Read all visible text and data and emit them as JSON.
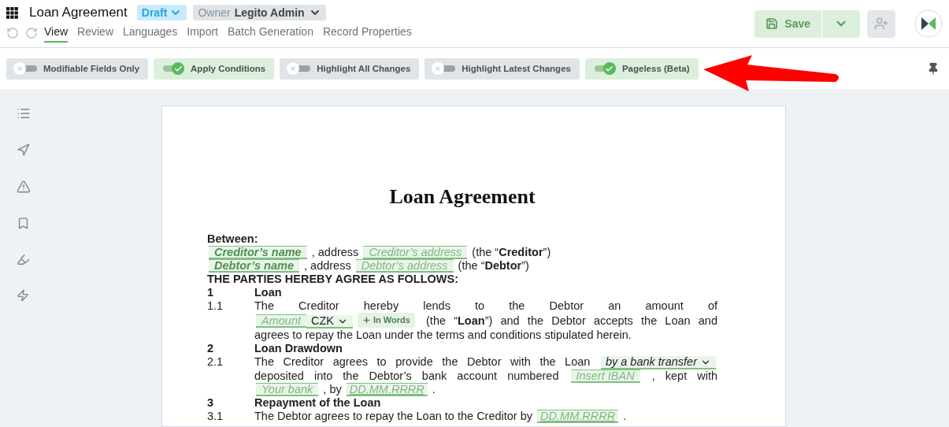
{
  "header": {
    "title": "Loan Agreement",
    "status": "Draft",
    "owner_label": "Owner",
    "owner_name": "Legito Admin"
  },
  "tabs": [
    {
      "label": "View",
      "selected": true
    },
    {
      "label": "Review",
      "selected": false
    },
    {
      "label": "Languages",
      "selected": false
    },
    {
      "label": "Import",
      "selected": false
    },
    {
      "label": "Batch Generation",
      "selected": false
    },
    {
      "label": "Record Properties",
      "selected": false
    }
  ],
  "save_button": {
    "label": "Save"
  },
  "toggles": [
    {
      "label": "Modifiable Fields Only",
      "on": false
    },
    {
      "label": "Apply Conditions",
      "on": true
    },
    {
      "label": "Highlight All Changes",
      "on": false
    },
    {
      "label": "Highlight Latest Changes",
      "on": false
    },
    {
      "label": "Pageless (Beta)",
      "on": true
    }
  ],
  "document": {
    "title": "Loan Agreement",
    "blocks": [
      {
        "kind": "plain",
        "lines": [
          [
            {
              "kind": "text",
              "text": "**Between:**"
            }
          ]
        ]
      },
      {
        "kind": "plain",
        "lines": [
          [
            {
              "kind": "field",
              "text": "Creditor’s name",
              "bold": true
            },
            {
              "kind": "text",
              "text": ", address"
            },
            {
              "kind": "field",
              "text": "Creditor’s address",
              "bold": false
            },
            {
              "kind": "text",
              "text": "(the “**Creditor**”)"
            }
          ]
        ]
      },
      {
        "kind": "plain",
        "lines": [
          [
            {
              "kind": "field",
              "text": "Debtor’s name",
              "bold": true
            },
            {
              "kind": "text",
              "text": ", address"
            },
            {
              "kind": "field",
              "text": "Debtor’s address",
              "bold": false
            },
            {
              "kind": "text",
              "text": "(the “**Debtor**”)"
            }
          ]
        ]
      },
      {
        "kind": "plain",
        "lines": [
          [
            {
              "kind": "text",
              "text": "**THE PARTIES HEREBY AGREE AS FOLLOWS:**"
            }
          ]
        ]
      },
      {
        "kind": "heading",
        "number": "1",
        "text": "Loan"
      },
      {
        "kind": "clause",
        "number": "1.1",
        "lines": [
          [
            {
              "kind": "text",
              "text": "The Creditor hereby lends to the Debtor an amount of"
            }
          ],
          [
            {
              "kind": "field",
              "text": "Amount",
              "bold": false
            },
            {
              "kind": "currency",
              "text": "CZK"
            },
            {
              "kind": "button",
              "text": "In Words"
            },
            {
              "kind": "text",
              "text": "(the “**Loan**”) and the Debtor accepts the Loan and"
            }
          ],
          [
            {
              "kind": "text",
              "text": "agrees to repay the Loan under the terms and conditions stipulated herein."
            }
          ]
        ]
      },
      {
        "kind": "heading",
        "number": "2",
        "text": "Loan Drawdown"
      },
      {
        "kind": "clause",
        "number": "2.1",
        "lines": [
          [
            {
              "kind": "text",
              "text": "The Creditor agrees to provide the Debtor with the Loan"
            },
            {
              "kind": "select",
              "text": "by a bank transfer"
            }
          ],
          [
            {
              "kind": "text",
              "text": "deposited into the Debtor’s bank account numbered"
            },
            {
              "kind": "field",
              "text": "Insert IBAN",
              "bold": false
            },
            {
              "kind": "text",
              "text": ", kept with"
            }
          ],
          [
            {
              "kind": "field",
              "text": "Your bank",
              "bold": false
            },
            {
              "kind": "text",
              "text": ", by"
            },
            {
              "kind": "date",
              "text": "DD.MM.RRRR"
            },
            {
              "kind": "text",
              "text": "."
            }
          ]
        ]
      },
      {
        "kind": "heading",
        "number": "3",
        "text": "Repayment of the Loan"
      },
      {
        "kind": "clause",
        "number": "3.1",
        "lines": [
          [
            {
              "kind": "text",
              "text": "The Debtor agrees to repay the Loan to the Creditor by"
            },
            {
              "kind": "date",
              "text": "DD.MM.RRRR"
            },
            {
              "kind": "text",
              "text": "."
            }
          ]
        ]
      }
    ]
  }
}
